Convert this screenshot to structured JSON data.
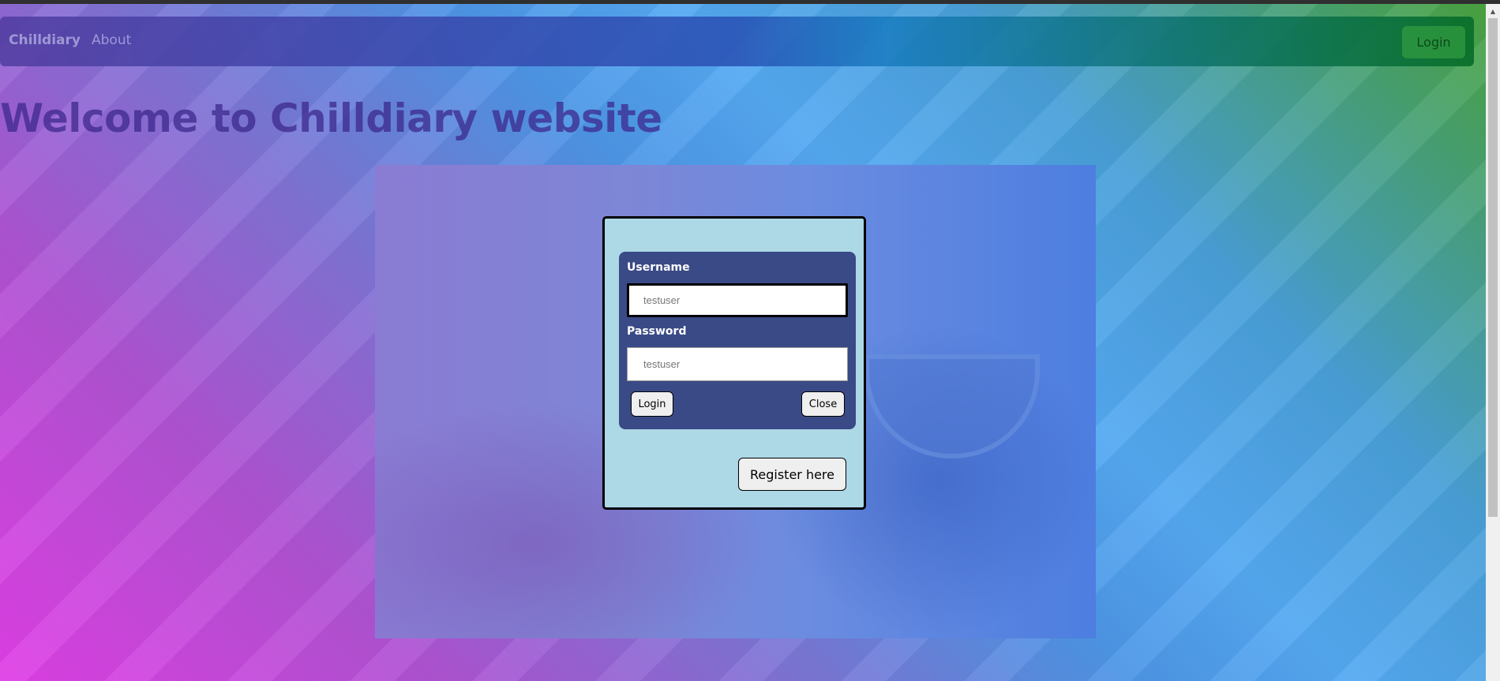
{
  "navbar": {
    "brand": "Chilldiary",
    "about": "About",
    "login": "Login"
  },
  "page": {
    "title": "Welcome to Chilldiary website"
  },
  "login_form": {
    "username_label": "Username",
    "username_placeholder": "testuser",
    "password_label": "Password",
    "password_placeholder": "testuser",
    "login_button": "Login",
    "close_button": "Close",
    "register_button": "Register here"
  },
  "scrollbar": {
    "up_icon": "triangle-up-icon"
  }
}
